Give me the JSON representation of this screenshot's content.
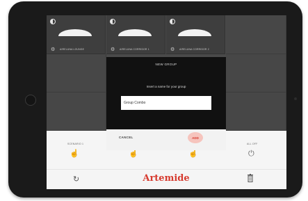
{
  "tiles": [
    {
      "name": "AIRELUNA LOUNGE"
    },
    {
      "name": "AIRELUNA CORRIDOR 1"
    },
    {
      "name": "AIRELUNA CORRIDOR 2"
    }
  ],
  "dialog": {
    "title": "NEW GROUP",
    "subtitle": "Insert a name for your group",
    "input_value": "Group Combo",
    "cancel_label": "CANCEL",
    "add_label": "ADD"
  },
  "controls": {
    "scenario_label": "SCENARIO 1",
    "all_off_label": "ALL OFF"
  },
  "footer": {
    "brand": "Artemide"
  },
  "icons": {
    "half_circle": "brightness-icon",
    "settings": "gear-icon",
    "scene": "scene-hand-icon",
    "power": "power-icon",
    "refresh": "refresh-icon",
    "trash": "trash-icon"
  },
  "colors": {
    "brand_red": "#d63a2e",
    "add_bg": "#f6c4bd",
    "dialog_bg": "#111111",
    "tile_bg": "#3e3e3e"
  }
}
